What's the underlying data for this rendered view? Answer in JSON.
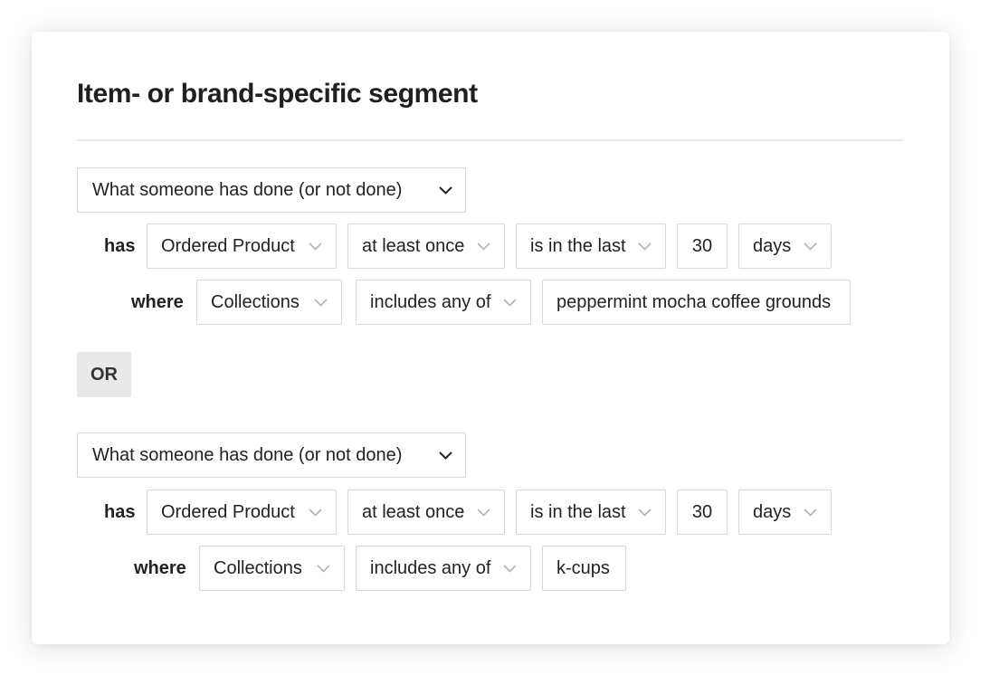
{
  "segment": {
    "title": "Item- or brand-specific segment",
    "or_label": "OR",
    "groups": [
      {
        "main_select": "What someone has done (or not done)",
        "has_label": "has",
        "event": "Ordered Product",
        "frequency": "at least once",
        "time_operator": "is in the last",
        "time_value": "30",
        "time_unit": "days",
        "where_label": "where",
        "property": "Collections",
        "property_operator": "includes any of",
        "property_value": "peppermint mocha coffee grounds"
      },
      {
        "main_select": "What someone has done (or not done)",
        "has_label": "has",
        "event": "Ordered Product",
        "frequency": "at least once",
        "time_operator": "is in the last",
        "time_value": "30",
        "time_unit": "days",
        "where_label": "where",
        "property": "Collections",
        "property_operator": "includes any of",
        "property_value": "k-cups"
      }
    ]
  },
  "icons": {
    "main_dropdown": "chevron-down-icon",
    "field_dropdown": "chevron-down-icon"
  },
  "colors": {
    "border": "#d9d9d9",
    "text": "#1f1f1f",
    "chevron_light": "#b3b3b3",
    "chevron_dark": "#222222",
    "or_background": "#e9e9e9"
  }
}
